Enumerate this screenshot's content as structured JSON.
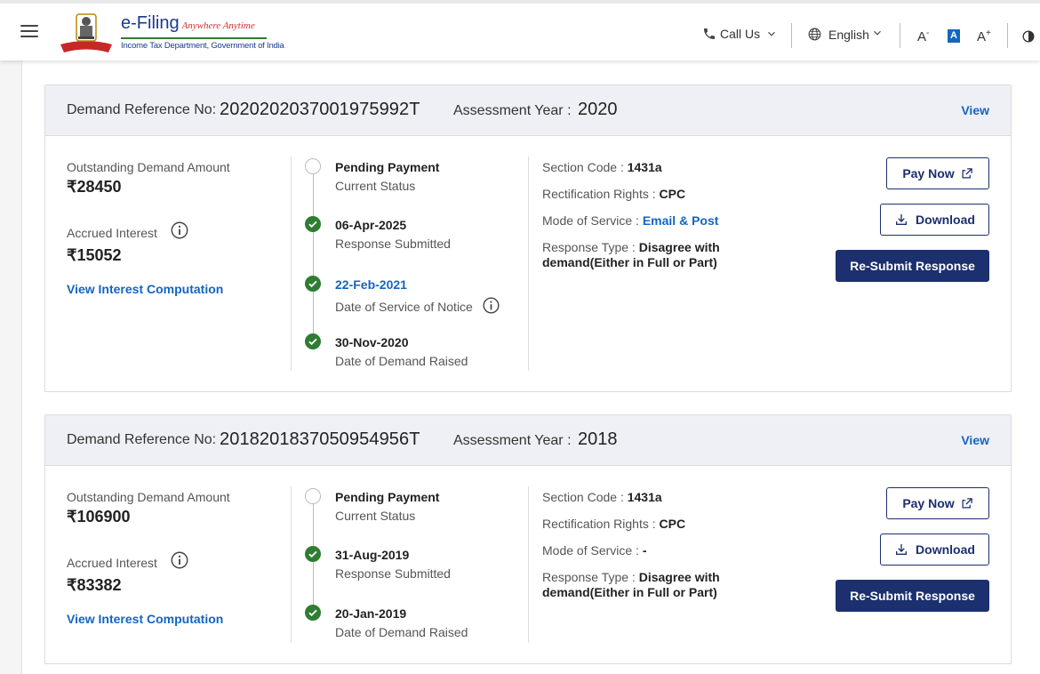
{
  "header": {
    "brand_main": "e-Filing",
    "brand_tagline": "Anywhere Anytime",
    "brand_sub": "Income Tax Department, Government of India",
    "call_us": "Call Us",
    "language": "English",
    "font_decrease": "A",
    "font_decrease_sup": "-",
    "font_standard": "A",
    "font_increase": "A",
    "font_increase_sup": "+"
  },
  "labels": {
    "demand_ref": "Demand Reference No:",
    "assessment_year": "Assessment Year :",
    "view": "View",
    "outstanding": "Outstanding Demand Amount",
    "accrued": "Accrued Interest",
    "view_interest": "View Interest Computation",
    "section_code": "Section Code :",
    "rectification": "Rectification Rights :",
    "mode_of_service": "Mode of Service :",
    "response_type": "Response Type :",
    "pay_now": "Pay Now",
    "download": "Download",
    "resubmit": "Re-Submit Response"
  },
  "demands": [
    {
      "ref_no": "2020202037001975992T",
      "assessment_year": "2020",
      "outstanding": "₹28450",
      "accrued_interest": "₹15052",
      "timeline": [
        {
          "title": "Pending Payment",
          "subtitle": "Current Status",
          "status": "pending"
        },
        {
          "title": "06-Apr-2025",
          "subtitle": "Response Submitted",
          "status": "done"
        },
        {
          "title": "22-Feb-2021",
          "subtitle": "Date of Service of Notice",
          "status": "done"
        },
        {
          "title": "30-Nov-2020",
          "subtitle": "Date of Demand Raised",
          "status": "done"
        }
      ],
      "section_code": "1431a",
      "rectification_rights": "CPC",
      "mode_of_service": "Email & Post",
      "response_type_line1": "Disagree with",
      "response_type_line2": "demand(Either in Full or Part)"
    },
    {
      "ref_no": "2018201837050954956T",
      "assessment_year": "2018",
      "outstanding": "₹106900",
      "accrued_interest": "₹83382",
      "timeline": [
        {
          "title": "Pending Payment",
          "subtitle": "Current Status",
          "status": "pending"
        },
        {
          "title": "31-Aug-2019",
          "subtitle": "Response Submitted",
          "status": "done"
        },
        {
          "title": "20-Jan-2019",
          "subtitle": "Date of Demand Raised",
          "status": "done"
        }
      ],
      "section_code": "1431a",
      "rectification_rights": "CPC",
      "mode_of_service": "-",
      "response_type_line1": "Disagree with",
      "response_type_line2": "demand(Either in Full or Part)"
    }
  ],
  "colors": {
    "brand_blue": "#1c2f6e",
    "link_blue": "#1565c0",
    "success_green": "#2e7d32"
  }
}
